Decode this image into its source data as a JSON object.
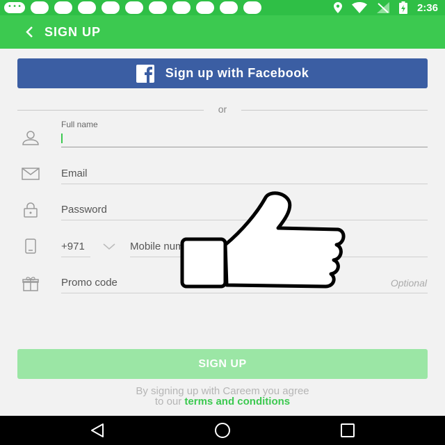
{
  "status_bar": {
    "time": "2:36",
    "background": "#2fbf46"
  },
  "header": {
    "title": "SIGN UP",
    "back_icon": "chevron-left-icon",
    "background": "#3cc950"
  },
  "facebook": {
    "label": "Sign up with Facebook",
    "icon": "facebook-icon",
    "color": "#3b5ea3"
  },
  "divider": {
    "text": "or"
  },
  "form": {
    "full_name": {
      "label": "Full name",
      "value": "",
      "icon": "person-icon"
    },
    "email": {
      "placeholder": "Email",
      "icon": "envelope-icon"
    },
    "password": {
      "placeholder": "Password",
      "icon": "lock-icon"
    },
    "mobile": {
      "country_code": "+971",
      "placeholder": "Mobile number",
      "icon": "phone-icon"
    },
    "promo": {
      "placeholder": "Promo code",
      "hint": "Optional",
      "icon": "gift-icon"
    }
  },
  "signup_button": {
    "label": "SIGN UP",
    "color": "#9be6a5"
  },
  "agreement": {
    "line1": "By signing up with Careem you agree",
    "line2_prefix": "to our",
    "terms_link": "terms and conditions"
  },
  "overlay": {
    "icon": "thumbs-up-icon"
  },
  "nav_bar": {
    "back": "back-nav-icon",
    "home": "home-nav-icon",
    "recents": "recents-nav-icon"
  }
}
